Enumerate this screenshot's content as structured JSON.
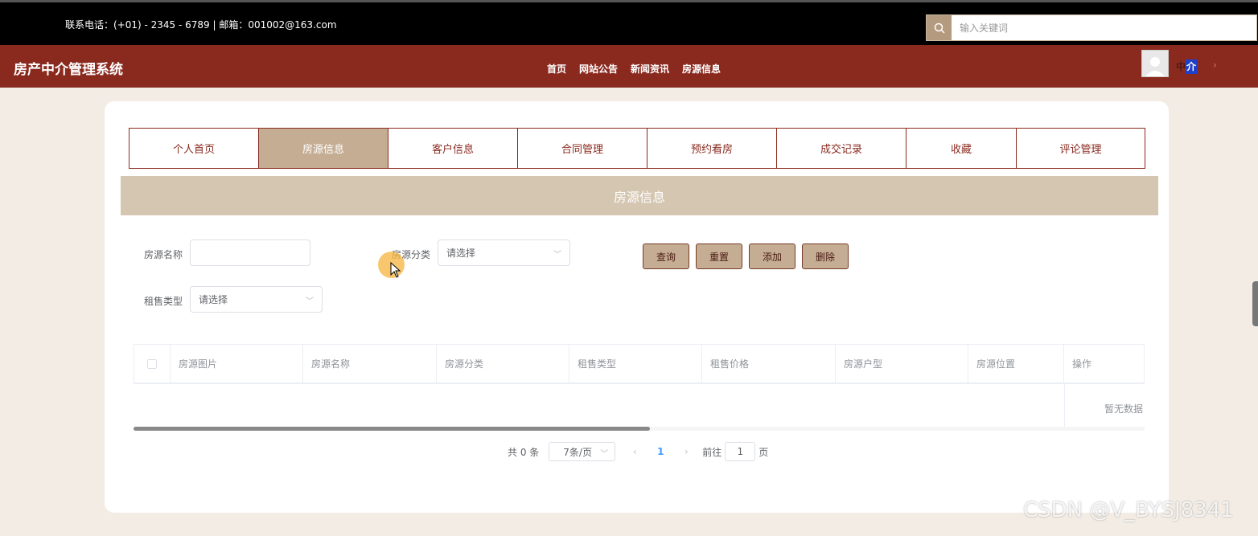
{
  "topbar": {
    "contact": "联系电话：(+01) - 2345 - 6789 | 邮箱：001002@163.com",
    "search_placeholder": "输入关键词"
  },
  "navbar": {
    "brand": "房产中介管理系统",
    "menu": [
      "首页",
      "网站公告",
      "新闻资讯",
      "房源信息"
    ],
    "user_label_prefix": "中",
    "user_label_highlight": "介",
    "user_arrow": "›"
  },
  "tabs": [
    {
      "label": "个人首页",
      "active": false
    },
    {
      "label": "房源信息",
      "active": true
    },
    {
      "label": "客户信息",
      "active": false
    },
    {
      "label": "合同管理",
      "active": false
    },
    {
      "label": "预约看房",
      "active": false
    },
    {
      "label": "成交记录",
      "active": false
    },
    {
      "label": "收藏",
      "active": false
    },
    {
      "label": "评论管理",
      "active": false
    }
  ],
  "section_title": "房源信息",
  "filters": {
    "name_label": "房源名称",
    "name_value": "",
    "category_label": "房源分类",
    "category_value": "请选择",
    "rent_type_label": "租售类型",
    "rent_type_value": "请选择"
  },
  "buttons": {
    "query": "查询",
    "reset": "重置",
    "add": "添加",
    "delete": "删除"
  },
  "table": {
    "columns": [
      "房源图片",
      "房源名称",
      "房源分类",
      "租售类型",
      "租售价格",
      "房源户型",
      "房源位置",
      "操作"
    ],
    "empty_text": "暂无数据"
  },
  "pagination": {
    "total_text": "共 0 条",
    "page_size": "7条/页",
    "current_page": "1",
    "goto_prefix": "前往",
    "goto_value": "1",
    "goto_suffix": "页"
  },
  "watermark": "CSDN @V_BYSJ8341",
  "colors": {
    "brand": "#8a2a1f",
    "accent": "#c4ad93",
    "banner": "#d5c6b1"
  }
}
